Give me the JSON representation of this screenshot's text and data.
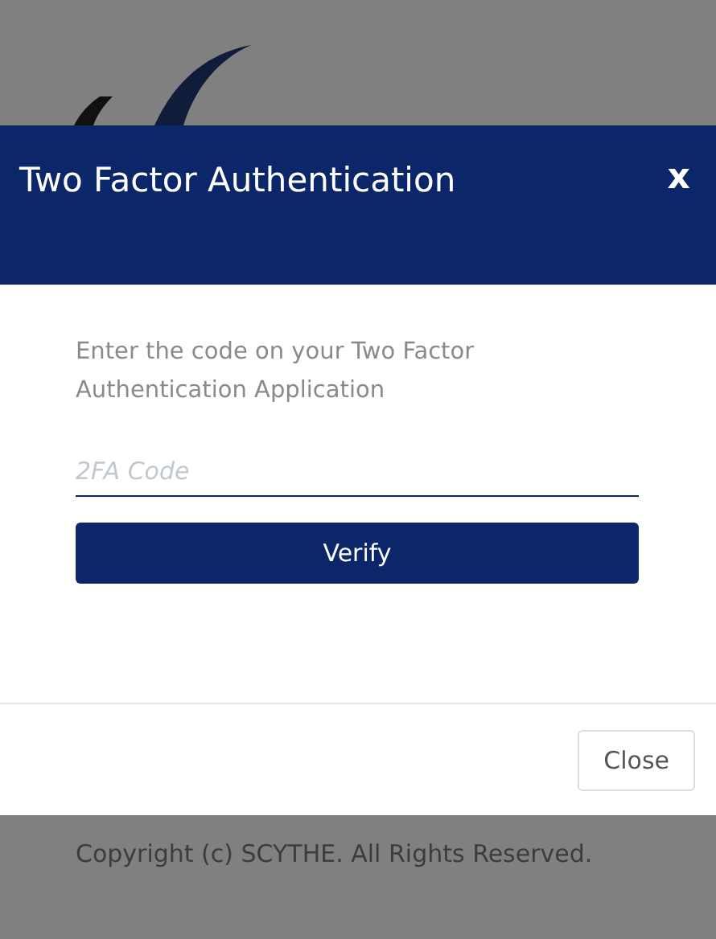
{
  "dialog": {
    "title": "Two Factor Authentication",
    "close_glyph": "x",
    "instructions": "Enter the code on your Two Factor Authentication Application",
    "code_field": {
      "placeholder": "2FA Code"
    },
    "verify_button": "Verify",
    "close_button": "Close"
  },
  "footer": {
    "copyright": "Copyright (c) SCYTHE. All Rights Reserved."
  }
}
